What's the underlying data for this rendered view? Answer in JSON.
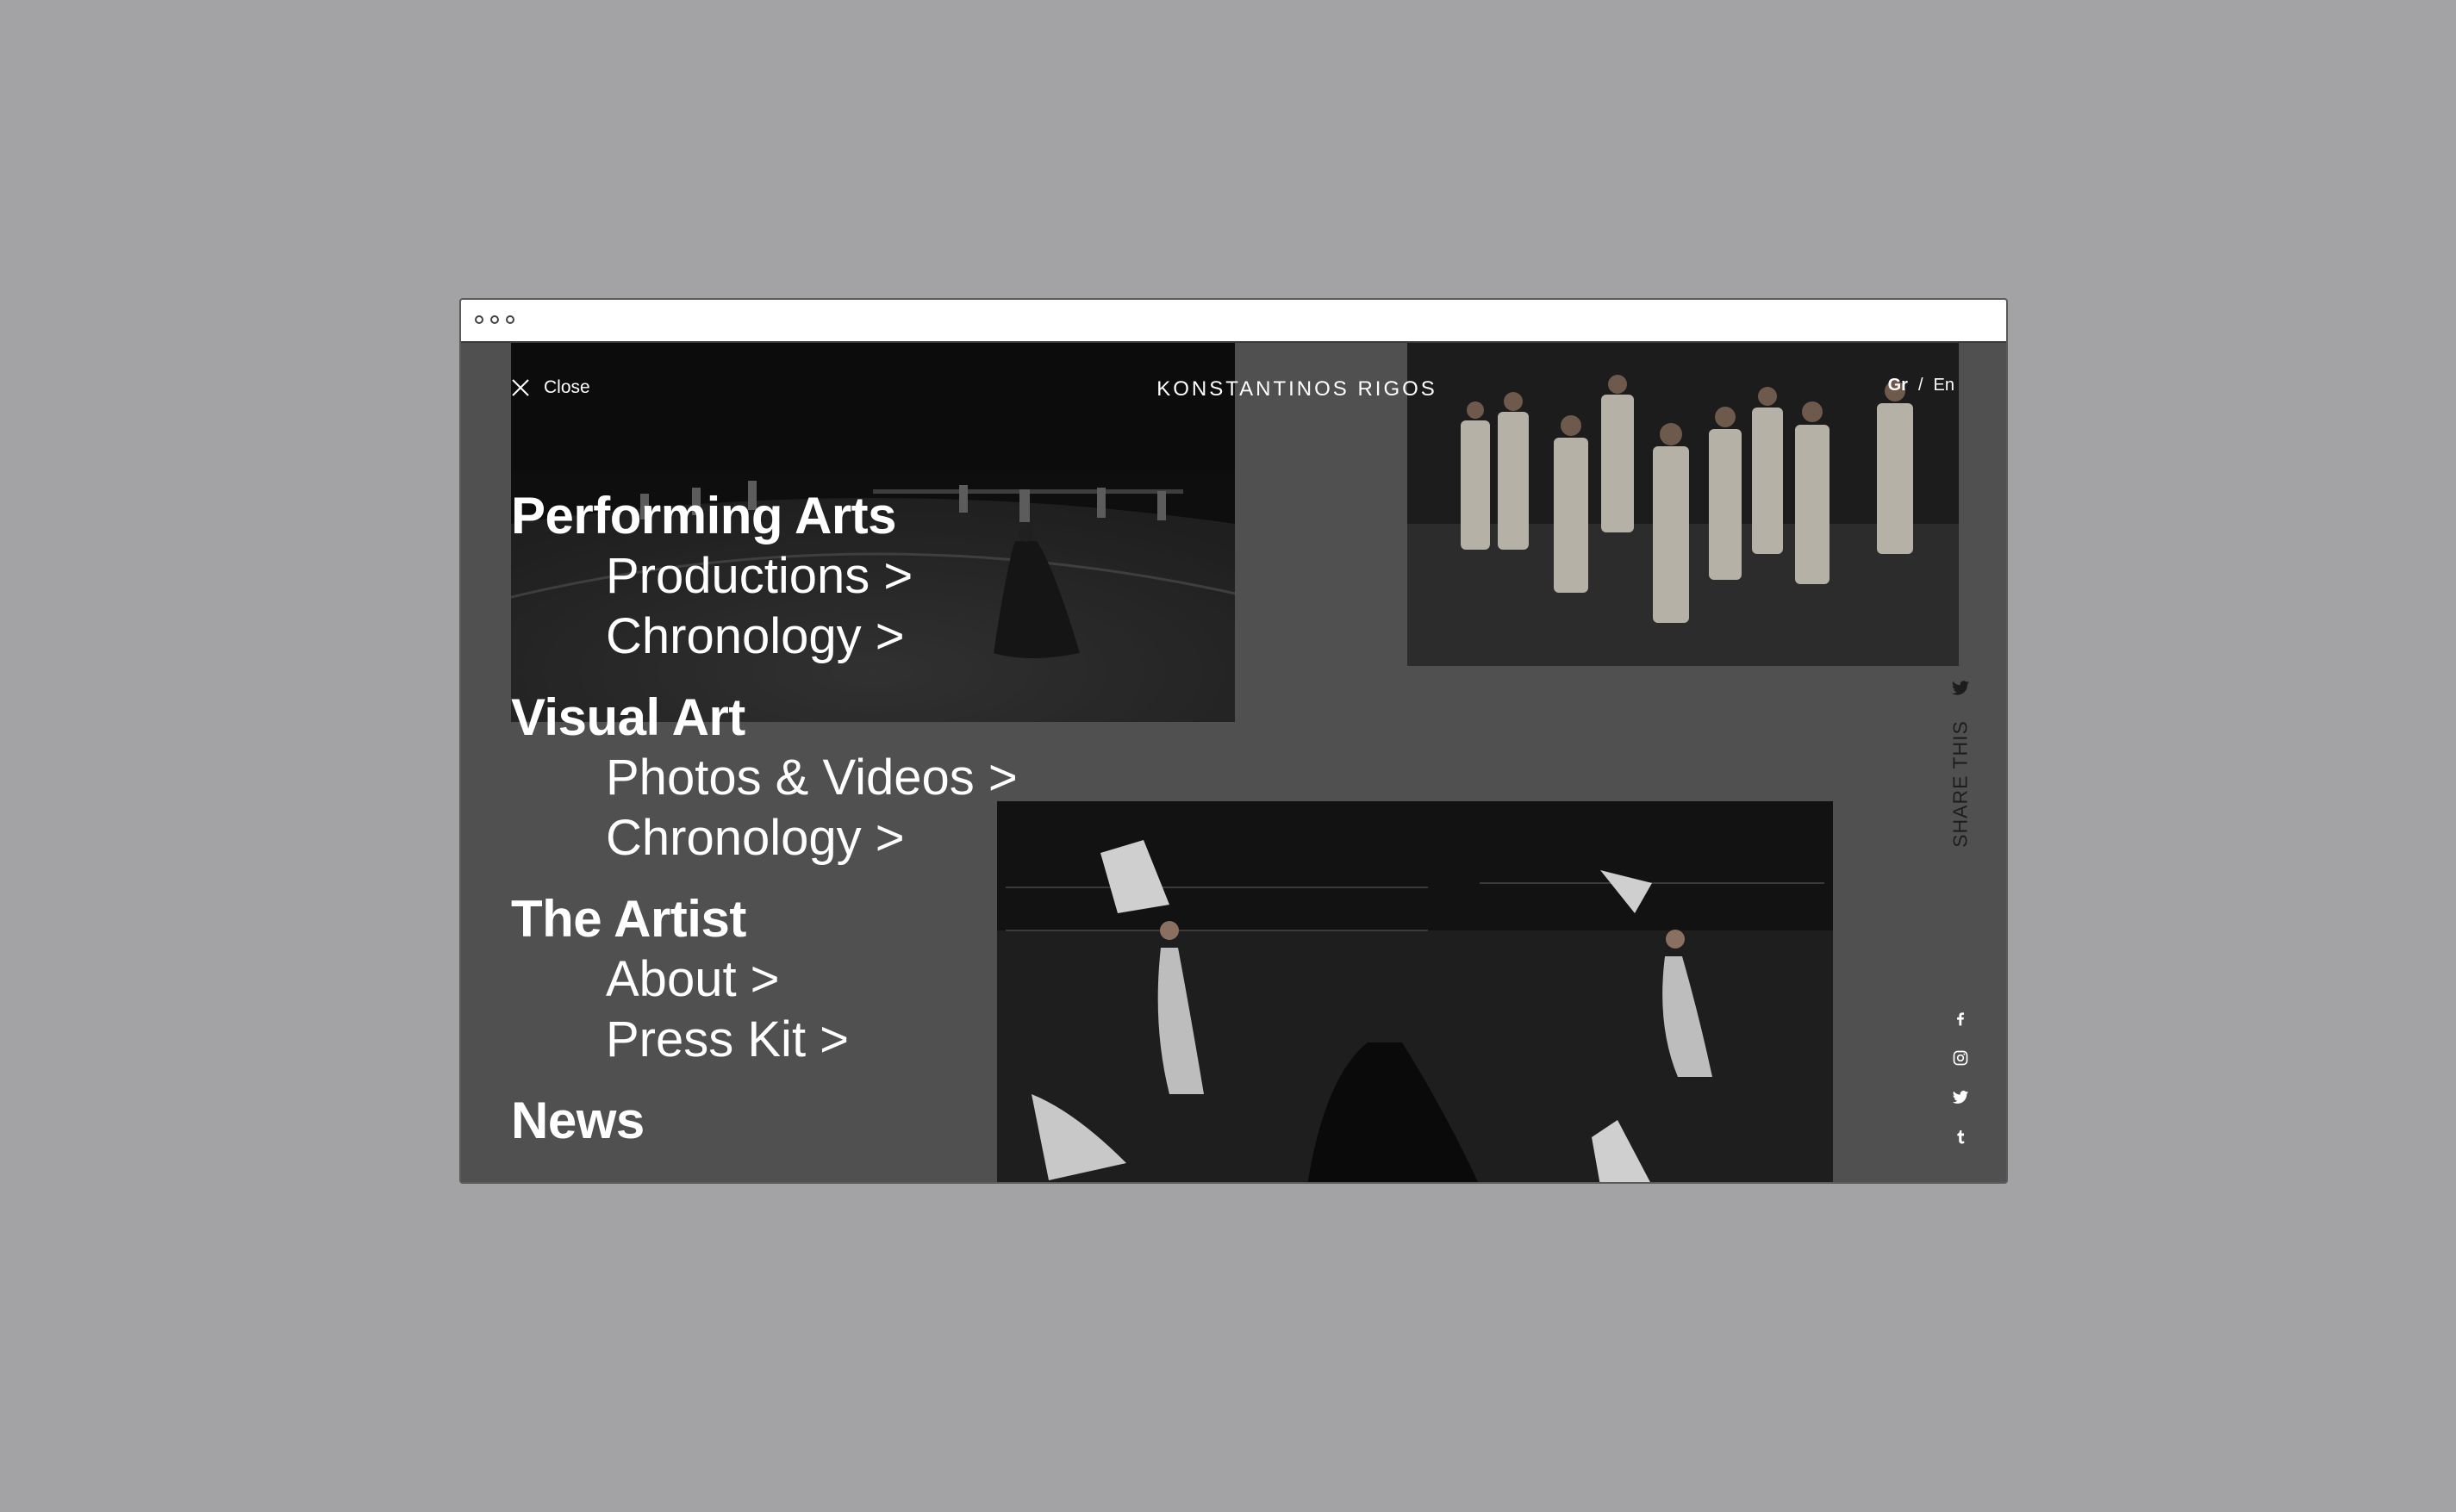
{
  "header": {
    "close_label": "Close",
    "site_title": "KONSTANTINOS RIGOS",
    "lang_gr": "Gr",
    "lang_sep": "/",
    "lang_en": "En"
  },
  "menu": {
    "performing_arts": {
      "heading": "Performing Arts",
      "productions": "Productions >",
      "chronology": "Chronology >"
    },
    "visual_art": {
      "heading": "Visual Art",
      "photos_videos": "Photos & Videos >",
      "chronology": "Chronology >"
    },
    "the_artist": {
      "heading": "The Artist",
      "about": "About >",
      "press_kit": "Press Kit >"
    },
    "news": {
      "heading": "News"
    }
  },
  "share": {
    "label": "SHARE THIS",
    "icons": [
      "twitter-icon",
      "facebook-icon",
      "instagram-icon",
      "twitter-icon",
      "tumblr-icon"
    ]
  },
  "colors": {
    "page_background": "#a3a3a5",
    "overlay": "#505050",
    "text": "#ffffff",
    "share_text": "#1d1d1d"
  }
}
